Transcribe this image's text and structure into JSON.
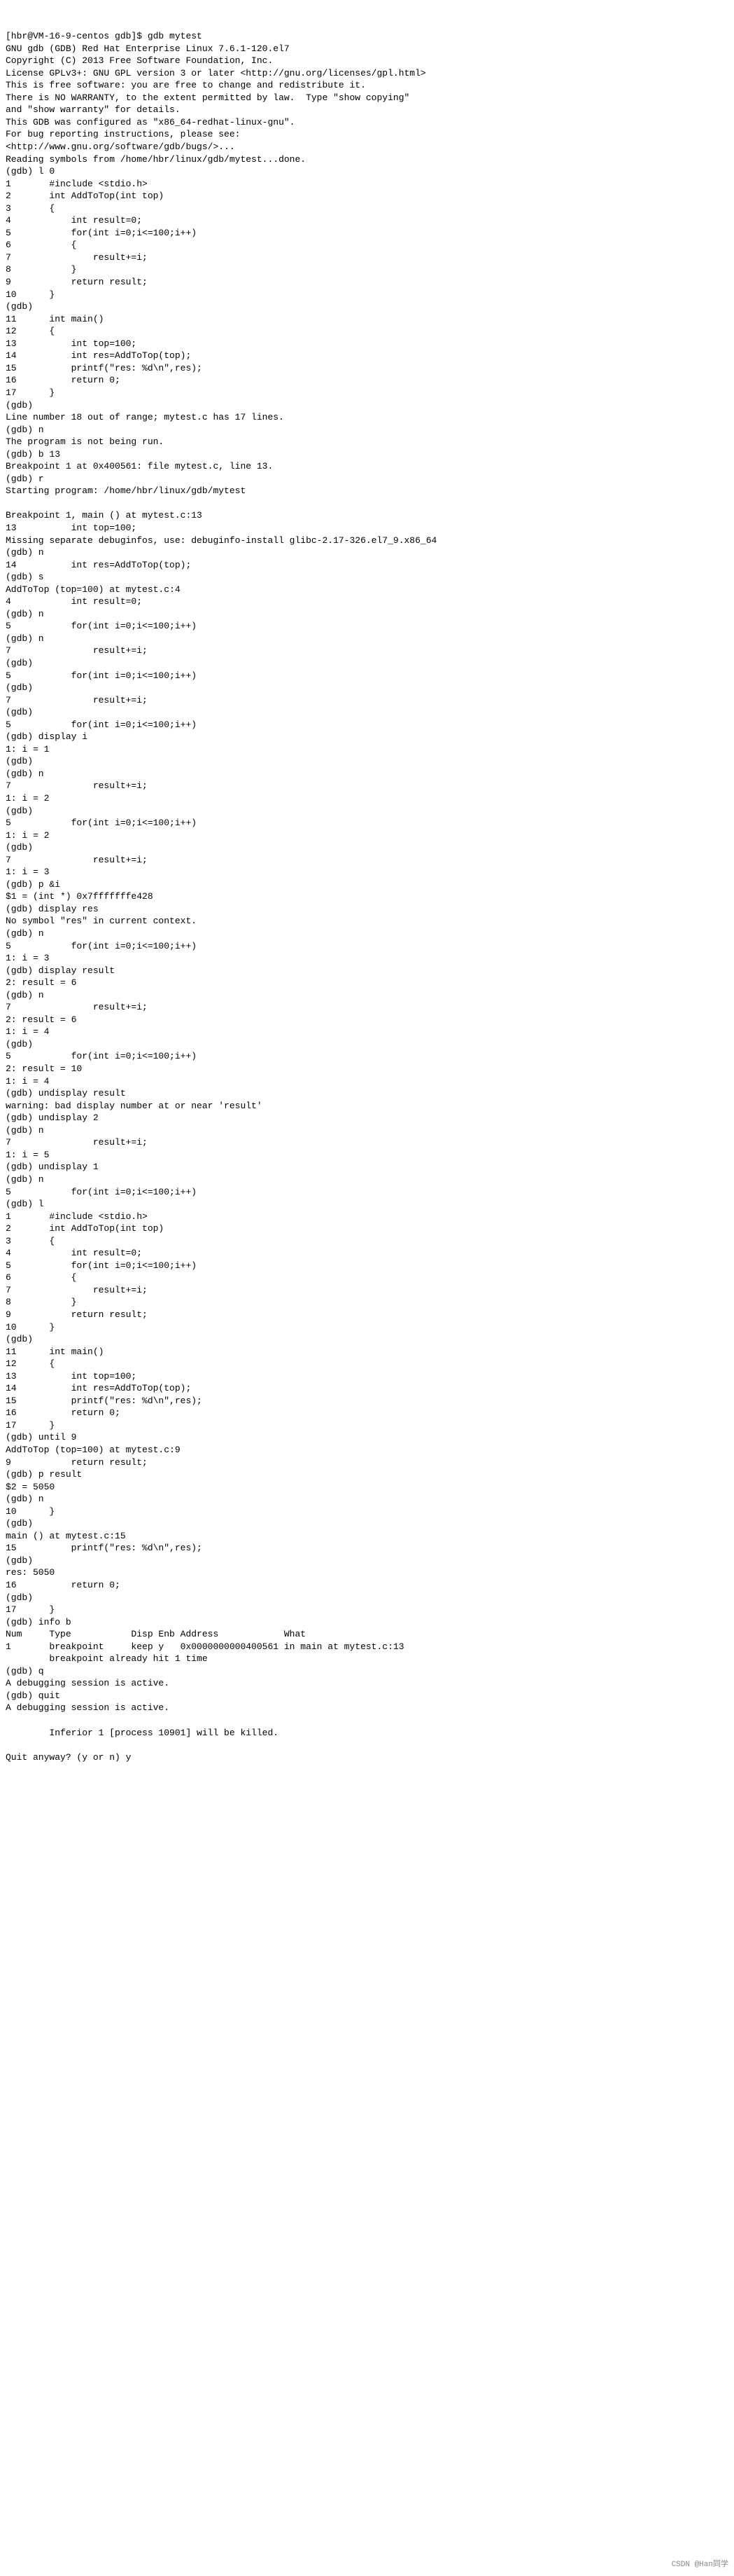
{
  "prompt": "[hbr@VM-16-9-centos gdb]$ ",
  "cmd": "gdb mytest",
  "banner": [
    "GNU gdb (GDB) Red Hat Enterprise Linux 7.6.1-120.el7",
    "Copyright (C) 2013 Free Software Foundation, Inc.",
    "License GPLv3+: GNU GPL version 3 or later <http://gnu.org/licenses/gpl.html>",
    "This is free software: you are free to change and redistribute it.",
    "There is NO WARRANTY, to the extent permitted by law.  Type \"show copying\"",
    "and \"show warranty\" for details.",
    "This GDB was configured as \"x86_64-redhat-linux-gnu\".",
    "For bug reporting instructions, please see:",
    "<http://www.gnu.org/software/gdb/bugs/>...",
    "Reading symbols from /home/hbr/linux/gdb/mytest...done."
  ],
  "gdb_prompt": "(gdb) ",
  "source_listing": {
    "1": "#include <stdio.h>",
    "2": "int AddToTop(int top)",
    "3": "{",
    "4": "    int result=0;",
    "5": "    for(int i=0;i<=100;i++)",
    "6": "    {",
    "7": "        result+=i;",
    "8": "    }",
    "9": "    return result;",
    "10": "}",
    "11": "int main()",
    "12": "{",
    "13": "    int top=100;",
    "14": "    int res=AddToTop(top);",
    "15": "    printf(\"res: %d\\n\",res);",
    "16": "    return 0;",
    "17": "}"
  },
  "session": [
    {
      "in": "l 0"
    },
    {
      "out": "1       #include <stdio.h>"
    },
    {
      "out": "2       int AddToTop(int top)"
    },
    {
      "out": "3       {"
    },
    {
      "out": "4           int result=0;"
    },
    {
      "out": "5           for(int i=0;i<=100;i++)"
    },
    {
      "out": "6           {"
    },
    {
      "out": "7               result+=i;"
    },
    {
      "out": "8           }"
    },
    {
      "out": "9           return result;"
    },
    {
      "out": "10      }"
    },
    {
      "in": ""
    },
    {
      "out": "11      int main()"
    },
    {
      "out": "12      {"
    },
    {
      "out": "13          int top=100;"
    },
    {
      "out": "14          int res=AddToTop(top);"
    },
    {
      "out": "15          printf(\"res: %d\\n\",res);"
    },
    {
      "out": "16          return 0;"
    },
    {
      "out": "17      }"
    },
    {
      "in": ""
    },
    {
      "out": "Line number 18 out of range; mytest.c has 17 lines."
    },
    {
      "in": "n"
    },
    {
      "out": "The program is not being run."
    },
    {
      "in": "b 13"
    },
    {
      "out": "Breakpoint 1 at 0x400561: file mytest.c, line 13."
    },
    {
      "in": "r"
    },
    {
      "out": "Starting program: /home/hbr/linux/gdb/mytest"
    },
    {
      "out": ""
    },
    {
      "out": "Breakpoint 1, main () at mytest.c:13"
    },
    {
      "out": "13          int top=100;"
    },
    {
      "out": "Missing separate debuginfos, use: debuginfo-install glibc-2.17-326.el7_9.x86_64"
    },
    {
      "in": "n"
    },
    {
      "out": "14          int res=AddToTop(top);"
    },
    {
      "in": "s"
    },
    {
      "out": "AddToTop (top=100) at mytest.c:4"
    },
    {
      "out": "4           int result=0;"
    },
    {
      "in": "n"
    },
    {
      "out": "5           for(int i=0;i<=100;i++)"
    },
    {
      "in": "n"
    },
    {
      "out": "7               result+=i;"
    },
    {
      "in": ""
    },
    {
      "out": "5           for(int i=0;i<=100;i++)"
    },
    {
      "in": ""
    },
    {
      "out": "7               result+=i;"
    },
    {
      "in": ""
    },
    {
      "out": "5           for(int i=0;i<=100;i++)"
    },
    {
      "in": "display i"
    },
    {
      "out": "1: i = 1"
    },
    {
      "in": ""
    },
    {
      "in": "n"
    },
    {
      "out": "7               result+=i;"
    },
    {
      "out": "1: i = 2"
    },
    {
      "in": ""
    },
    {
      "out": "5           for(int i=0;i<=100;i++)"
    },
    {
      "out": "1: i = 2"
    },
    {
      "in": ""
    },
    {
      "out": "7               result+=i;"
    },
    {
      "out": "1: i = 3"
    },
    {
      "in": "p &i"
    },
    {
      "out": "$1 = (int *) 0x7fffffffe428"
    },
    {
      "in": "display res"
    },
    {
      "out": "No symbol \"res\" in current context."
    },
    {
      "in": "n"
    },
    {
      "out": "5           for(int i=0;i<=100;i++)"
    },
    {
      "out": "1: i = 3"
    },
    {
      "in": "display result"
    },
    {
      "out": "2: result = 6"
    },
    {
      "in": "n"
    },
    {
      "out": "7               result+=i;"
    },
    {
      "out": "2: result = 6"
    },
    {
      "out": "1: i = 4"
    },
    {
      "in": ""
    },
    {
      "out": "5           for(int i=0;i<=100;i++)"
    },
    {
      "out": "2: result = 10"
    },
    {
      "out": "1: i = 4"
    },
    {
      "in": "undisplay result"
    },
    {
      "out": "warning: bad display number at or near 'result'"
    },
    {
      "in": "undisplay 2"
    },
    {
      "in": "n"
    },
    {
      "out": "7               result+=i;"
    },
    {
      "out": "1: i = 5"
    },
    {
      "in": "undisplay 1"
    },
    {
      "in": "n"
    },
    {
      "out": "5           for(int i=0;i<=100;i++)"
    },
    {
      "in": "l"
    },
    {
      "out": "1       #include <stdio.h>"
    },
    {
      "out": "2       int AddToTop(int top)"
    },
    {
      "out": "3       {"
    },
    {
      "out": "4           int result=0;"
    },
    {
      "out": "5           for(int i=0;i<=100;i++)"
    },
    {
      "out": "6           {"
    },
    {
      "out": "7               result+=i;"
    },
    {
      "out": "8           }"
    },
    {
      "out": "9           return result;"
    },
    {
      "out": "10      }"
    },
    {
      "in": ""
    },
    {
      "out": "11      int main()"
    },
    {
      "out": "12      {"
    },
    {
      "out": "13          int top=100;"
    },
    {
      "out": "14          int res=AddToTop(top);"
    },
    {
      "out": "15          printf(\"res: %d\\n\",res);"
    },
    {
      "out": "16          return 0;"
    },
    {
      "out": "17      }"
    },
    {
      "in": "until 9"
    },
    {
      "out": "AddToTop (top=100) at mytest.c:9"
    },
    {
      "out": "9           return result;"
    },
    {
      "in": "p result"
    },
    {
      "out": "$2 = 5050"
    },
    {
      "in": "n"
    },
    {
      "out": "10      }"
    },
    {
      "in": ""
    },
    {
      "out": "main () at mytest.c:15"
    },
    {
      "out": "15          printf(\"res: %d\\n\",res);"
    },
    {
      "in": ""
    },
    {
      "out": "res: 5050"
    },
    {
      "out": "16          return 0;"
    },
    {
      "in": ""
    },
    {
      "out": "17      }"
    },
    {
      "in": "info b"
    },
    {
      "out": "Num     Type           Disp Enb Address            What"
    },
    {
      "out": "1       breakpoint     keep y   0x0000000000400561 in main at mytest.c:13"
    },
    {
      "out": "        breakpoint already hit 1 time"
    },
    {
      "in": "q"
    },
    {
      "out": "A debugging session is active."
    },
    {
      "in": "quit"
    },
    {
      "out": "A debugging session is active."
    },
    {
      "out": ""
    },
    {
      "out": "        Inferior 1 [process 10901] will be killed."
    },
    {
      "out": ""
    },
    {
      "out": "Quit anyway? (y or n) y"
    }
  ],
  "watermark": "CSDN @Han同学"
}
